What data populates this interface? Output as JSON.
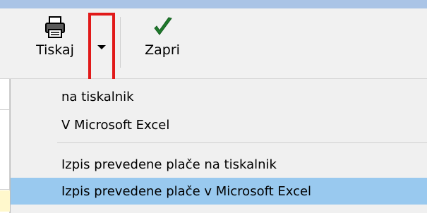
{
  "toolbar": {
    "print_button": {
      "label": "Tiskaj",
      "icon": "printer-icon"
    },
    "close_button": {
      "label": "Zapri",
      "icon": "checkmark-icon",
      "icon_color": "#1f7a2c"
    },
    "dropdown_arrow_icon": "chevron-down-icon",
    "highlight_color": "#e11a1a"
  },
  "menu": {
    "items": [
      {
        "label": "na tiskalnik"
      },
      {
        "label": "V Microsoft Excel"
      },
      {
        "label": "Izpis prevedene plače na tiskalnik"
      },
      {
        "label": "Izpis prevedene plače v Microsoft Excel",
        "highlighted": true
      }
    ],
    "highlight_color": "#99c9ef"
  }
}
